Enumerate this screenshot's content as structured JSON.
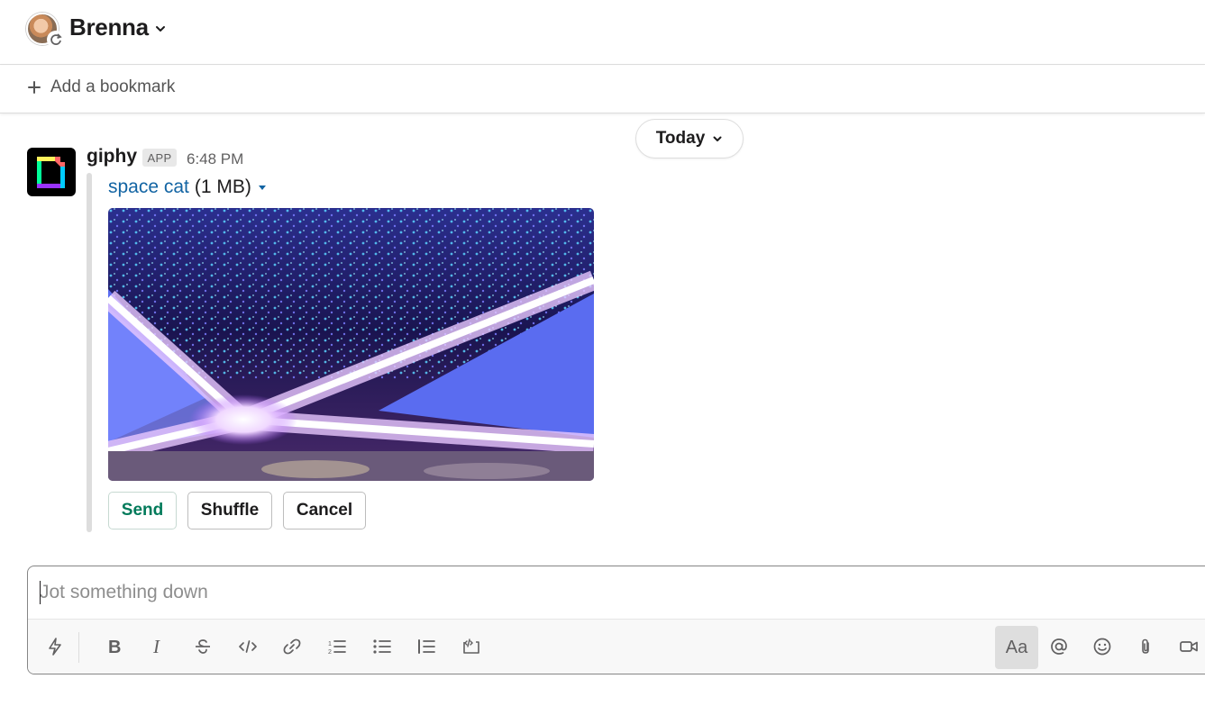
{
  "header": {
    "channel_name": "Brenna"
  },
  "bookmarks": {
    "add_label": "Add a bookmark"
  },
  "date_divider": {
    "label": "Today"
  },
  "message": {
    "sender": "giphy",
    "badge": "APP",
    "time": "6:48 PM",
    "attachment": {
      "title": "space cat",
      "size": "(1 MB)"
    },
    "actions": {
      "send": "Send",
      "shuffle": "Shuffle",
      "cancel": "Cancel"
    }
  },
  "composer": {
    "placeholder": "Jot something down",
    "value": "",
    "text_format_label": "Aa"
  },
  "colors": {
    "link": "#1264a3",
    "send_green": "#007a5a",
    "divider": "#dddddd"
  },
  "icons": {
    "bookmark": "plus-icon",
    "chevron": "chevron-down-icon",
    "shortcuts": "lightning-icon",
    "bold": "bold-icon",
    "italic": "italic-icon",
    "strike": "strikethrough-icon",
    "code": "code-icon",
    "link": "link-icon",
    "ordered": "ordered-list-icon",
    "bulleted": "bulleted-list-icon",
    "blockquote": "blockquote-icon",
    "codeblock": "code-block-icon",
    "mention": "at-icon",
    "emoji": "emoji-icon",
    "attach": "paperclip-icon",
    "video": "video-icon"
  }
}
